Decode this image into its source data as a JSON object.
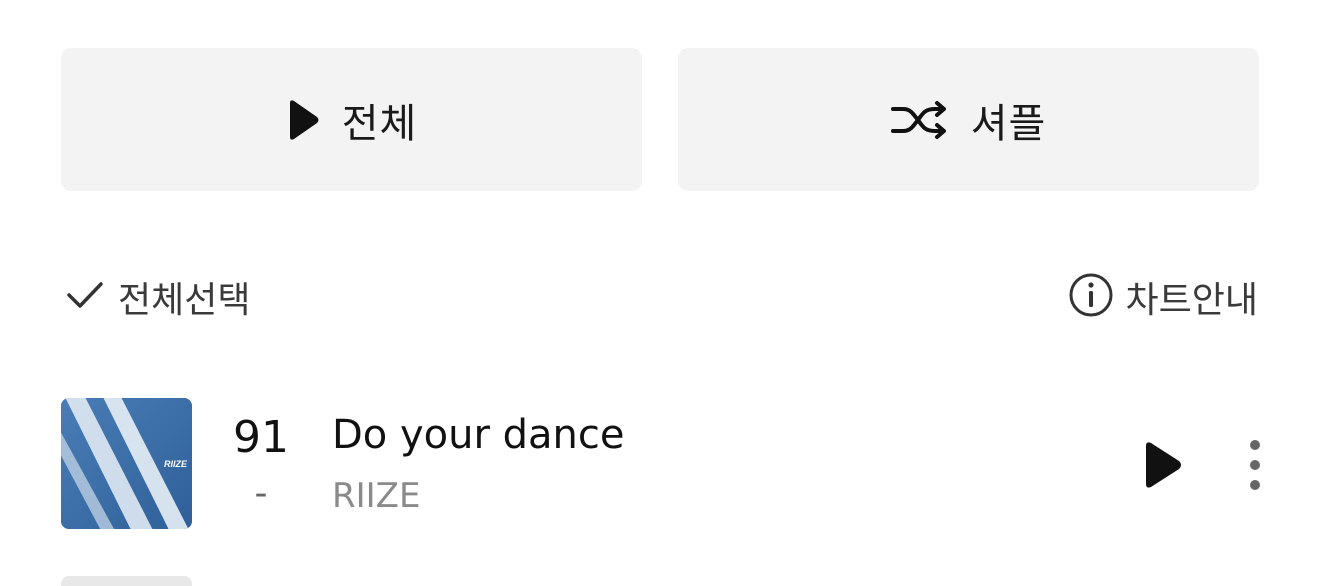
{
  "actions": {
    "play_all_label": "전체",
    "shuffle_label": "셔플"
  },
  "list_controls": {
    "select_all_label": "전체선택",
    "chart_info_label": "차트안내"
  },
  "tracks": [
    {
      "rank": "91",
      "rank_change": "-",
      "title": "Do your dance",
      "artist": "RIIZE",
      "album_art_text": "RIIZE"
    }
  ],
  "icons": {
    "play": "play-icon",
    "shuffle": "shuffle-icon",
    "check": "check-icon",
    "info": "info-icon",
    "more": "more-vertical-icon"
  },
  "colors": {
    "button_bg": "#f3f3f3",
    "text_primary": "#111111",
    "text_secondary": "#8a8a8a",
    "album_sky": "#3d6fa8"
  }
}
